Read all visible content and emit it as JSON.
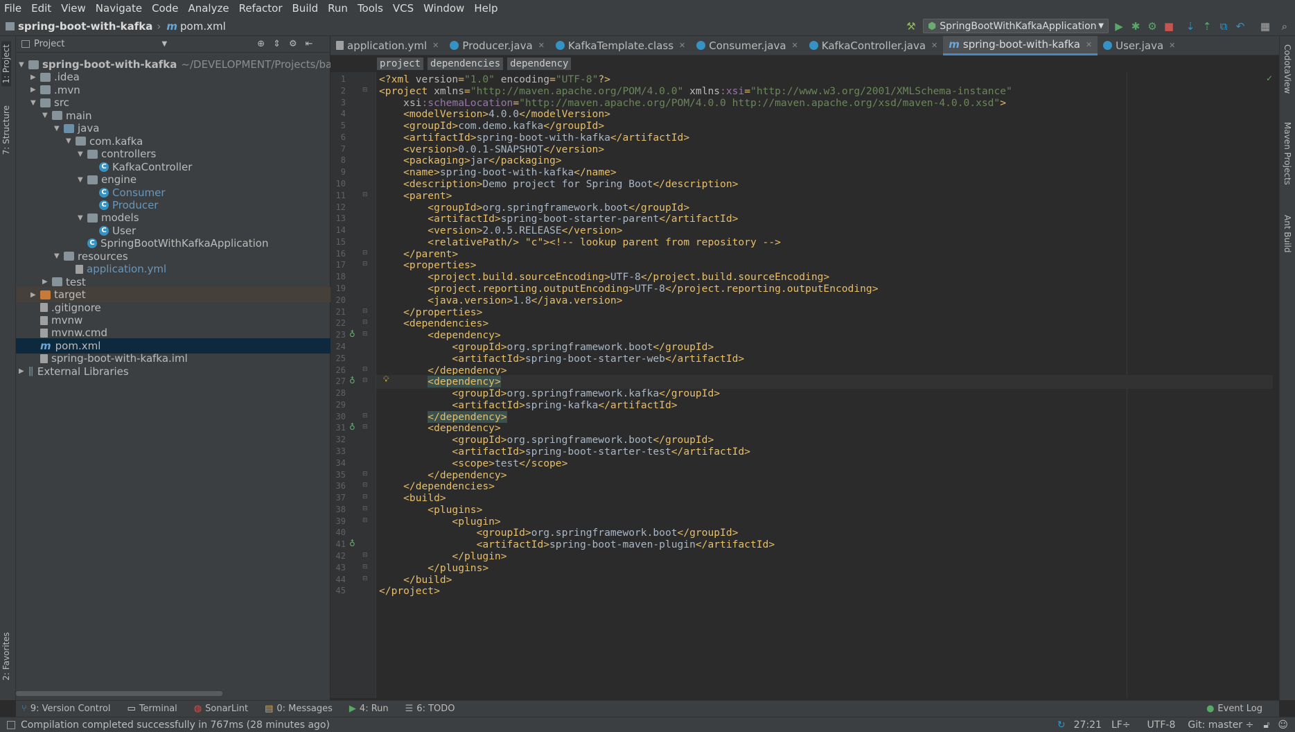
{
  "menu": [
    "File",
    "Edit",
    "View",
    "Navigate",
    "Code",
    "Analyze",
    "Refactor",
    "Build",
    "Run",
    "Tools",
    "VCS",
    "Window",
    "Help"
  ],
  "nav": {
    "project": "spring-boot-with-kafka",
    "file": "pom.xml",
    "run_config": "SpringBootWithKafkaApplication"
  },
  "left_strip": {
    "project": "1: Project",
    "structure": "7: Structure",
    "favorites": "2: Favorites"
  },
  "right_strip": {
    "codota": "CodotaView",
    "maven": "Maven Projects",
    "ant": "Ant Build"
  },
  "project_panel": {
    "title": "Project",
    "tree": [
      {
        "label": "spring-boot-with-kafka",
        "extra": "~/DEVELOPMENT/Projects/back-en",
        "depth": 0,
        "arrow": "▼",
        "icon": "module"
      },
      {
        "label": ".idea",
        "depth": 1,
        "arrow": "▶",
        "icon": "folder"
      },
      {
        "label": ".mvn",
        "depth": 1,
        "arrow": "▶",
        "icon": "folder"
      },
      {
        "label": "src",
        "depth": 1,
        "arrow": "▼",
        "icon": "folder"
      },
      {
        "label": "main",
        "depth": 2,
        "arrow": "▼",
        "icon": "folder"
      },
      {
        "label": "java",
        "depth": 3,
        "arrow": "▼",
        "icon": "src"
      },
      {
        "label": "com.kafka",
        "depth": 4,
        "arrow": "▼",
        "icon": "folder"
      },
      {
        "label": "controllers",
        "depth": 5,
        "arrow": "▼",
        "icon": "folder"
      },
      {
        "label": "KafkaController",
        "depth": 6,
        "arrow": "",
        "icon": "class"
      },
      {
        "label": "engine",
        "depth": 5,
        "arrow": "▼",
        "icon": "folder"
      },
      {
        "label": "Consumer",
        "depth": 6,
        "arrow": "",
        "icon": "class",
        "color": "#6897bb"
      },
      {
        "label": "Producer",
        "depth": 6,
        "arrow": "",
        "icon": "class",
        "color": "#6897bb"
      },
      {
        "label": "models",
        "depth": 5,
        "arrow": "▼",
        "icon": "folder"
      },
      {
        "label": "User",
        "depth": 6,
        "arrow": "",
        "icon": "class"
      },
      {
        "label": "SpringBootWithKafkaApplication",
        "depth": 5,
        "arrow": "",
        "icon": "class"
      },
      {
        "label": "resources",
        "depth": 3,
        "arrow": "▼",
        "icon": "folder"
      },
      {
        "label": "application.yml",
        "depth": 4,
        "arrow": "",
        "icon": "file",
        "color": "#6897bb"
      },
      {
        "label": "test",
        "depth": 2,
        "arrow": "▶",
        "icon": "folder"
      },
      {
        "label": "target",
        "depth": 1,
        "arrow": "▶",
        "icon": "orange",
        "state": "hl"
      },
      {
        "label": ".gitignore",
        "depth": 1,
        "arrow": "",
        "icon": "file"
      },
      {
        "label": "mvnw",
        "depth": 1,
        "arrow": "",
        "icon": "file"
      },
      {
        "label": "mvnw.cmd",
        "depth": 1,
        "arrow": "",
        "icon": "file"
      },
      {
        "label": "pom.xml",
        "depth": 1,
        "arrow": "",
        "icon": "maven",
        "state": "sel"
      },
      {
        "label": "spring-boot-with-kafka.iml",
        "depth": 1,
        "arrow": "",
        "icon": "file"
      },
      {
        "label": "External Libraries",
        "depth": 0,
        "arrow": "▶",
        "icon": "lib"
      }
    ]
  },
  "tabs": [
    {
      "label": "application.yml",
      "kind": "file"
    },
    {
      "label": "Producer.java",
      "kind": "class"
    },
    {
      "label": "KafkaTemplate.class",
      "kind": "class"
    },
    {
      "label": "Consumer.java",
      "kind": "class"
    },
    {
      "label": "KafkaController.java",
      "kind": "class"
    },
    {
      "label": "spring-boot-with-kafka",
      "kind": "maven",
      "active": true
    },
    {
      "label": "User.java",
      "kind": "class"
    }
  ],
  "breadcrumbs": [
    "project",
    "dependencies",
    "dependency"
  ],
  "code": [
    "<?xml version=\"1.0\" encoding=\"UTF-8\"?>",
    "<project xmlns=\"http://maven.apache.org/POM/4.0.0\" xmlns:xsi=\"http://www.w3.org/2001/XMLSchema-instance\"",
    "    xsi:schemaLocation=\"http://maven.apache.org/POM/4.0.0 http://maven.apache.org/xsd/maven-4.0.0.xsd\">",
    "    <modelVersion>4.0.0</modelVersion>",
    "    <groupId>com.demo.kafka</groupId>",
    "    <artifactId>spring-boot-with-kafka</artifactId>",
    "    <version>0.0.1-SNAPSHOT</version>",
    "    <packaging>jar</packaging>",
    "    <name>spring-boot-with-kafka</name>",
    "    <description>Demo project for Spring Boot</description>",
    "    <parent>",
    "        <groupId>org.springframework.boot</groupId>",
    "        <artifactId>spring-boot-starter-parent</artifactId>",
    "        <version>2.0.5.RELEASE</version>",
    "        <relativePath/> <!-- lookup parent from repository -->",
    "    </parent>",
    "    <properties>",
    "        <project.build.sourceEncoding>UTF-8</project.build.sourceEncoding>",
    "        <project.reporting.outputEncoding>UTF-8</project.reporting.outputEncoding>",
    "        <java.version>1.8</java.version>",
    "    </properties>",
    "    <dependencies>",
    "        <dependency>",
    "            <groupId>org.springframework.boot</groupId>",
    "            <artifactId>spring-boot-starter-web</artifactId>",
    "        </dependency>",
    "        <dependency>",
    "            <groupId>org.springframework.kafka</groupId>",
    "            <artifactId>spring-kafka</artifactId>",
    "        </dependency>",
    "        <dependency>",
    "            <groupId>org.springframework.boot</groupId>",
    "            <artifactId>spring-boot-starter-test</artifactId>",
    "            <scope>test</scope>",
    "        </dependency>",
    "    </dependencies>",
    "    <build>",
    "        <plugins>",
    "            <plugin>",
    "                <groupId>org.springframework.boot</groupId>",
    "                <artifactId>spring-boot-maven-plugin</artifactId>",
    "            </plugin>",
    "        </plugins>",
    "    </build>",
    "</project>"
  ],
  "current_line": 27,
  "bottom_tabs": [
    "9: Version Control",
    "Terminal",
    "SonarLint",
    "0: Messages",
    "4: Run",
    "6: TODO"
  ],
  "event_log": "Event Log",
  "status": {
    "message": "Compilation completed successfully in 767ms (28 minutes ago)",
    "position": "27:21",
    "line_sep": "LF÷",
    "encoding": "UTF-8",
    "git": "Git: master ÷"
  },
  "colors": {
    "accent": "#4a88c7",
    "bg": "#2b2b2b",
    "panel": "#3c3f41"
  }
}
